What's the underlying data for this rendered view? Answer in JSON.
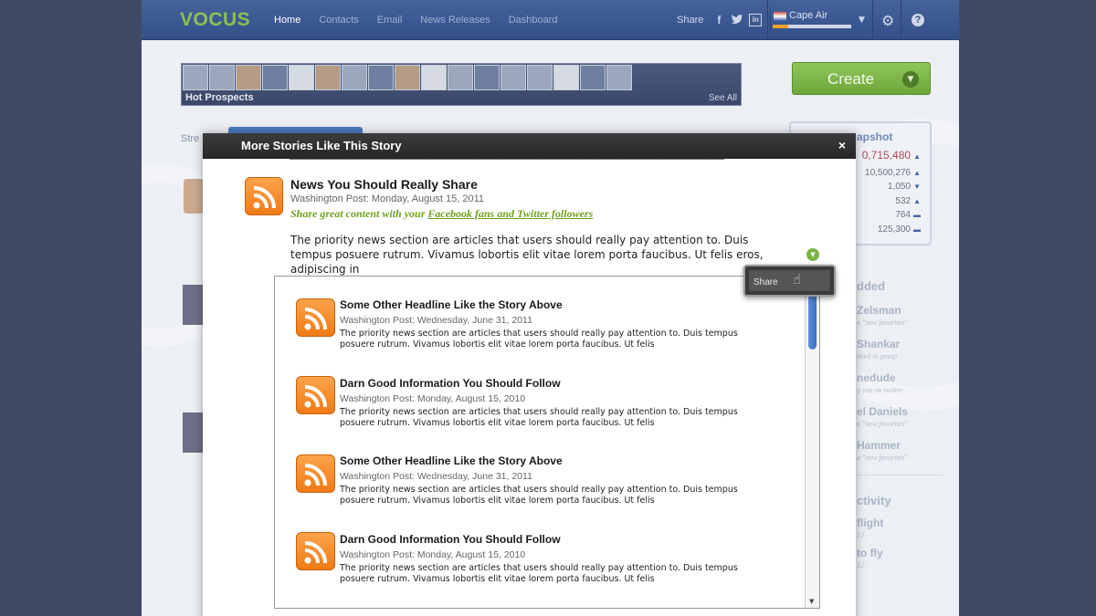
{
  "app": {
    "logo": "VOCUS",
    "nav": [
      "Home",
      "Contacts",
      "Email",
      "News Releases",
      "Dashboard"
    ],
    "share_label": "Share",
    "account_name": "Cape Air",
    "hot_prospects": {
      "title": "Hot Prospects",
      "see_all": "See All"
    },
    "create_label": "Create",
    "streams_label": "Stre",
    "snapshot": {
      "header": "apshot",
      "values": [
        "0,715,480",
        "10,500,276",
        "1,050",
        "532",
        "764",
        "125,300"
      ]
    },
    "sidebar": {
      "added_header": "dded",
      "people": [
        {
          "name": "Zelsman",
          "sub": "a \"new favorites\""
        },
        {
          "name": "Shankar",
          "sub": "nked in group"
        },
        {
          "name": "nedude",
          "sub": "g you on twitter"
        },
        {
          "name": "el Daniels",
          "sub": "a \"new favorites\""
        },
        {
          "name": "Hammer",
          "sub": "a \"new favorites\""
        }
      ],
      "activity_header": "ctivity",
      "activity": [
        "flight",
        "12",
        "to fly",
        "12"
      ]
    }
  },
  "modal": {
    "title": "More Stories Like This Story",
    "close_label": "×",
    "main_story": {
      "title": "News You Should Really Share",
      "source": "Washington Post:",
      "date": "Monday, August 15, 2011",
      "promo_prefix": "Share great content with your ",
      "promo_link": "Facebook fans and Twitter followers",
      "body": "The priority news section are articles that users should really pay attention to. Duis tempus posuere rutrum. Vivamus lobortis elit vitae lorem porta faucibus. Ut felis eros, adipiscing in"
    },
    "share_popup_label": "Share",
    "stories": [
      {
        "title": "Some Other Headline Like the Story Above",
        "source": "Washington Post:",
        "date": "Wednesday, June 31, 2011",
        "body": "The priority news section are articles that users should really pay attention to. Duis tempus posuere rutrum. Vivamus lobortis elit vitae lorem porta faucibus. Ut felis"
      },
      {
        "title": "Darn Good Information You Should Follow",
        "source": "Washington Post:",
        "date": "Monday, August 15, 2010",
        "body": "The priority news section are articles that users should really pay attention to. Duis tempus posuere rutrum. Vivamus lobortis elit vitae lorem porta faucibus. Ut felis"
      },
      {
        "title": "Some Other Headline Like the Story Above",
        "source": "Washington Post:",
        "date": "Wednesday, June 31, 2011",
        "body": "The priority news section are articles that users should really pay attention to. Duis tempus posuere rutrum. Vivamus lobortis elit vitae lorem porta faucibus. Ut felis"
      },
      {
        "title": "Darn Good Information You Should Follow",
        "source": "Washington Post:",
        "date": "Monday, August 15, 2010",
        "body": "The priority news section are articles that users should really pay attention to. Duis tempus posuere rutrum. Vivamus lobortis elit vitae lorem porta faucibus. Ut felis"
      }
    ]
  },
  "icons": {
    "rss": "rss-feed-icon",
    "close": "close-icon",
    "gear": "gear-icon",
    "help": "help-icon",
    "dropdown": "chevron-down-icon"
  },
  "colors": {
    "brand_green": "#8cc152",
    "header_blue": "#34508a",
    "rss_orange": "#f07b16",
    "promo_green": "#6ea21e"
  }
}
